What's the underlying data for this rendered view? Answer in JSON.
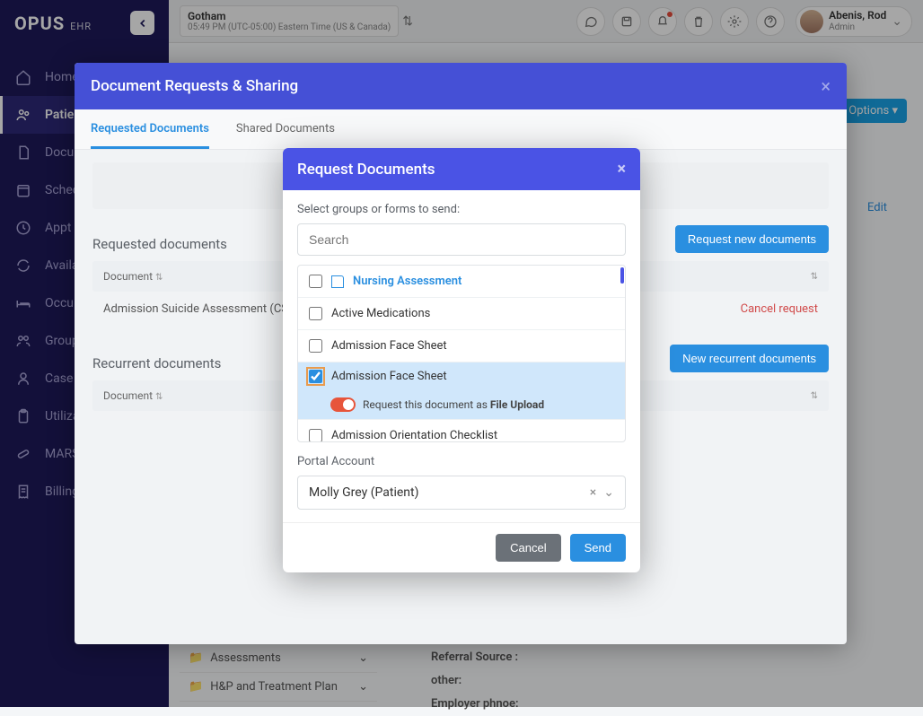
{
  "brand": {
    "name": "OPUS",
    "sub": "EHR"
  },
  "header": {
    "location": "Gotham",
    "tz": "05:49 PM (UTC-05:00) Eastern Time (US & Canada)",
    "user_name": "Abenis, Rod",
    "user_role": "Admin"
  },
  "sidebar": {
    "items": [
      {
        "label": "Home",
        "icon": "home"
      },
      {
        "label": "Patients",
        "icon": "users",
        "active": true
      },
      {
        "label": "Documents",
        "icon": "doc"
      },
      {
        "label": "Scheduler",
        "icon": "calendar"
      },
      {
        "label": "Appt Queue",
        "icon": "clock"
      },
      {
        "label": "Availability",
        "icon": "refresh"
      },
      {
        "label": "Occupancy",
        "icon": "bed"
      },
      {
        "label": "Group Sessions",
        "icon": "group"
      },
      {
        "label": "Case Load",
        "icon": "person"
      },
      {
        "label": "Utilization",
        "icon": "clipboard"
      },
      {
        "label": "MARS",
        "icon": "pill"
      },
      {
        "label": "Billing",
        "icon": "receipt"
      }
    ]
  },
  "page": {
    "options_btn": "Options",
    "edit_link": "Edit",
    "tree": [
      "Assessments",
      "H&P and Treatment Plan"
    ],
    "info_labels": [
      "Referral Source :",
      "other:",
      "Employer phnoe:"
    ]
  },
  "modal1": {
    "title": "Document Requests & Sharing",
    "tabs": [
      "Requested Documents",
      "Shared Documents"
    ],
    "section1": "Requested documents",
    "btn1": "Request new documents",
    "col_doc": "Document",
    "row1": "Admission Suicide Assessment (CSSRS)",
    "row1_action": "Cancel request",
    "section2": "Recurrent documents",
    "btn2": "New recurrent documents"
  },
  "modal2": {
    "title": "Request Documents",
    "label_select": "Select groups or forms to send:",
    "search_placeholder": "Search",
    "items": [
      {
        "label": "Nursing Assessment",
        "group": true
      },
      {
        "label": "Active Medications"
      },
      {
        "label": "Admission Face Sheet"
      },
      {
        "label": "Admission Face Sheet",
        "selected": true
      },
      {
        "label": "Admission Orientation Checklist"
      }
    ],
    "toggle_prefix": "Request this document as ",
    "toggle_bold": "File Upload",
    "portal_label": "Portal Account",
    "portal_value": "Molly Grey (Patient)",
    "btn_cancel": "Cancel",
    "btn_send": "Send"
  }
}
